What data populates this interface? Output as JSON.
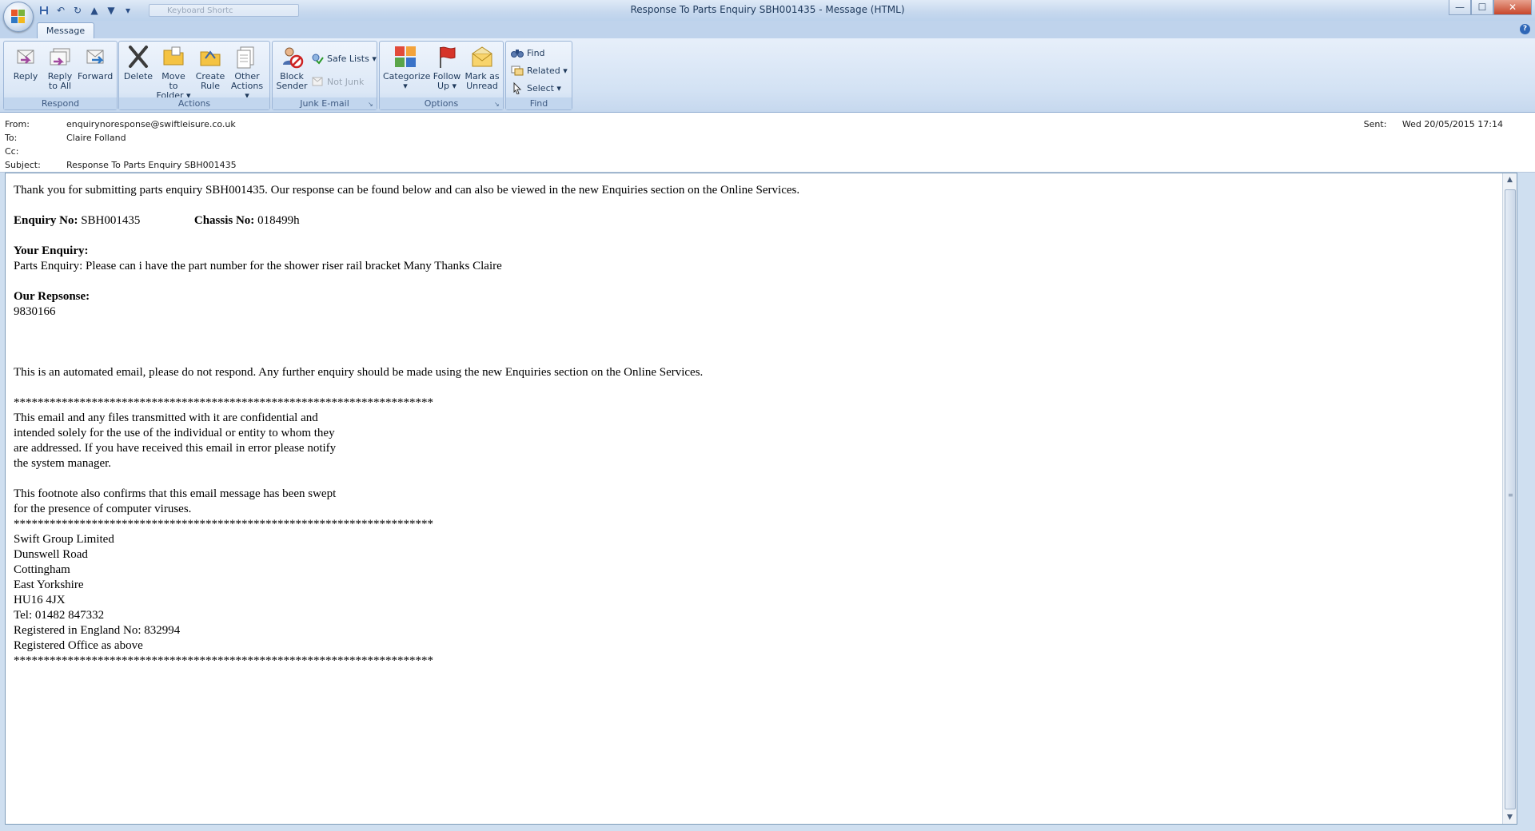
{
  "window": {
    "title": "Response To Parts Enquiry SBH001435 - Message (HTML)",
    "controls": {
      "minimize": "—",
      "maximize": "☐",
      "close": "✕"
    }
  },
  "qat": {
    "search_placeholder": "Keyboard Shortc"
  },
  "tabs": {
    "message": "Message"
  },
  "ribbon": {
    "respond": {
      "label": "Respond",
      "reply": "Reply",
      "reply_all_1": "Reply",
      "reply_all_2": "to All",
      "forward": "Forward"
    },
    "actions": {
      "label": "Actions",
      "delete": "Delete",
      "move_1": "Move to",
      "move_2": "Folder ▾",
      "rule_1": "Create",
      "rule_2": "Rule",
      "other_1": "Other",
      "other_2": "Actions ▾"
    },
    "junk": {
      "label": "Junk E-mail",
      "block_1": "Block",
      "block_2": "Sender",
      "safe_lists": "Safe Lists ▾",
      "not_junk": "Not Junk"
    },
    "options": {
      "label": "Options",
      "categorize_1": "Categorize",
      "categorize_2": "▾",
      "follow_1": "Follow",
      "follow_2": "Up ▾",
      "mark_1": "Mark as",
      "mark_2": "Unread"
    },
    "find": {
      "label": "Find",
      "find": "Find",
      "related": "Related ▾",
      "select": "Select ▾"
    }
  },
  "header": {
    "from_label": "From:",
    "from": "enquirynoresponse@swiftleisure.co.uk",
    "to_label": "To:",
    "to": "Claire Folland",
    "cc_label": "Cc:",
    "cc": "",
    "subject_label": "Subject:",
    "subject": "Response To Parts Enquiry SBH001435",
    "sent_label": "Sent:",
    "sent": "Wed 20/05/2015 17:14"
  },
  "body": {
    "intro": "Thank you for submitting parts enquiry SBH001435. Our response can be found below and can also be viewed in the new Enquiries section on the Online Services.",
    "enquiry_no_label": "Enquiry No:",
    "enquiry_no": "SBH001435",
    "chassis_no_label": "Chassis No:",
    "chassis_no": "018499h",
    "your_enquiry_label": "Your Enquiry:",
    "your_enquiry": "Parts Enquiry: Please can i have the part number for the shower riser rail bracket Many Thanks Claire",
    "our_response_label": "Our Repsonse:",
    "our_response": "9830166",
    "automated": "This is an automated email, please do not respond. Any further enquiry should be made using the new Enquiries section on the Online Services.",
    "stars": "**********************************************************************",
    "confidential": [
      "This email and any files transmitted with it are confidential and",
      "intended solely for the use of the individual or entity to whom they",
      "are addressed. If you have received this email in error please notify",
      "the system manager."
    ],
    "footnote": [
      "This footnote also confirms that this email message has been swept",
      "for the presence of computer viruses."
    ],
    "address": [
      "Swift Group Limited",
      "Dunswell Road",
      "Cottingham",
      "East Yorkshire",
      "HU16 4JX",
      "Tel: 01482 847332",
      "Registered in England No: 832994",
      "Registered Office as above"
    ]
  }
}
